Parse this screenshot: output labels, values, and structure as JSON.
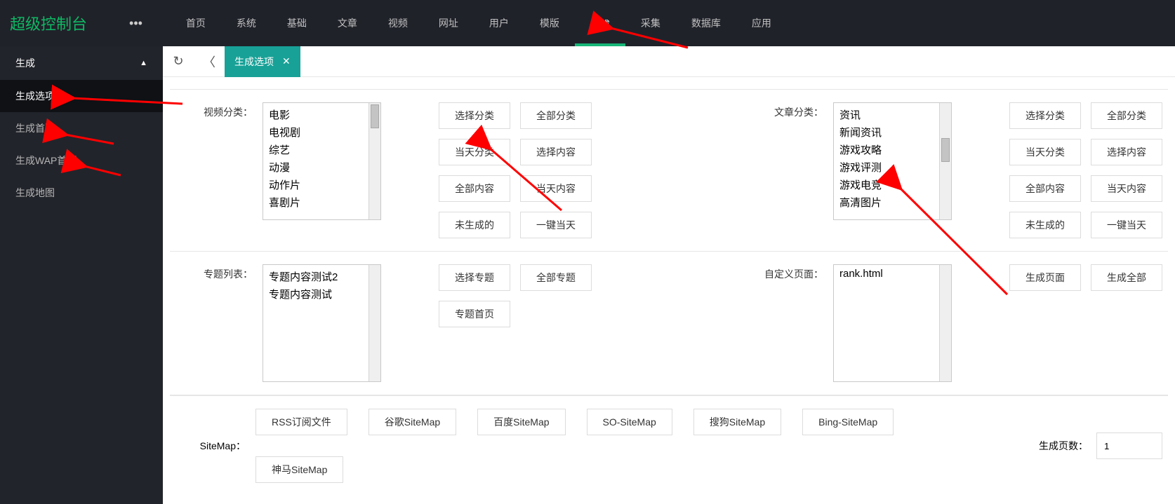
{
  "logo": "超级控制台",
  "topnav": [
    "首页",
    "系统",
    "基础",
    "文章",
    "视频",
    "网址",
    "用户",
    "模版",
    "生成",
    "采集",
    "数据库",
    "应用"
  ],
  "topnav_active": 8,
  "sidebar": {
    "group": "生成",
    "items": [
      "生成选项",
      "生成首页",
      "生成WAP首页",
      "生成地图"
    ],
    "active": 0
  },
  "tab": {
    "label": "生成选项"
  },
  "video": {
    "label": "视频分类：",
    "options": [
      "电影",
      "电视剧",
      "综艺",
      "动漫",
      "动作片",
      "喜剧片"
    ],
    "btns_left": [
      "选择分类",
      "当天分类",
      "全部内容",
      "未生成的"
    ],
    "btns_right": [
      "全部分类",
      "选择内容",
      "当天内容",
      "一键当天"
    ]
  },
  "article": {
    "label": "文章分类：",
    "options": [
      "资讯",
      "新闻资讯",
      "游戏攻略",
      "游戏评测",
      "游戏电竞",
      "高清图片"
    ],
    "btns_left": [
      "选择分类",
      "当天分类",
      "全部内容",
      "未生成的"
    ],
    "btns_right": [
      "全部分类",
      "选择内容",
      "当天内容",
      "一键当天"
    ]
  },
  "topic": {
    "label": "专题列表：",
    "options": [
      "专题内容测试2",
      "专题内容测试"
    ],
    "btns_left": [
      "选择专题",
      "专题首页"
    ],
    "btns_right": [
      "全部专题"
    ]
  },
  "custom": {
    "label": "自定义页面：",
    "value": "rank.html",
    "btns": [
      "生成页面",
      "生成全部"
    ]
  },
  "sitemap": {
    "label": "SiteMap：",
    "btns": [
      "RSS订阅文件",
      "谷歌SiteMap",
      "百度SiteMap",
      "SO-SiteMap",
      "搜狗SiteMap",
      "Bing-SiteMap",
      "神马SiteMap"
    ],
    "pages_label": "生成页数：",
    "pages_value": "1"
  }
}
